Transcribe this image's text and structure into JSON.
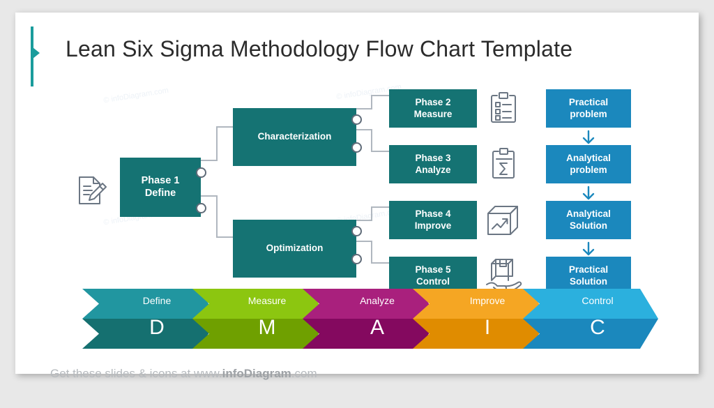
{
  "slide": {
    "title": "Lean Six Sigma Methodology Flow Chart Template",
    "watermark": "© infoDiagram.com",
    "accent_color": "#1a9c9c",
    "background": "#ffffff"
  },
  "diagram": {
    "colors": {
      "teal": "#157373",
      "blue": "#1b88bd",
      "connector": "#b0b7bf",
      "icon": "#6b7683"
    },
    "root": {
      "label_line1": "Phase 1",
      "label_line2": "Define",
      "icon": "document-pencil-icon"
    },
    "branches": [
      {
        "label": "Characterization"
      },
      {
        "label": "Optimization"
      }
    ],
    "phases": [
      {
        "label_line1": "Phase 2",
        "label_line2": "Measure",
        "icon": "clipboard-checklist-icon"
      },
      {
        "label_line1": "Phase 3",
        "label_line2": "Analyze",
        "icon": "clipboard-sigma-icon"
      },
      {
        "label_line1": "Phase 4",
        "label_line2": "Improve",
        "icon": "box-growth-arrow-icon"
      },
      {
        "label_line1": "Phase 5",
        "label_line2": "Control",
        "icon": "box-on-hand-icon"
      }
    ],
    "outcomes": [
      {
        "line1": "Practical",
        "line2": "problem"
      },
      {
        "line1": "Analytical",
        "line2": "problem"
      },
      {
        "line1": "Analytical",
        "line2": "Solution"
      },
      {
        "line1": "Practical",
        "line2": "Solution"
      }
    ]
  },
  "dmaic": {
    "steps": [
      {
        "label": "Define",
        "letter": "D",
        "top_color": "#2196a0",
        "bottom_color": "#157070"
      },
      {
        "label": "Measure",
        "letter": "M",
        "top_color": "#8cc610",
        "bottom_color": "#6fa000"
      },
      {
        "label": "Analyze",
        "letter": "A",
        "top_color": "#a9207d",
        "bottom_color": "#84095f"
      },
      {
        "label": "Improve",
        "letter": "I",
        "top_color": "#f5a623",
        "bottom_color": "#e08c00"
      },
      {
        "label": "Control",
        "letter": "C",
        "top_color": "#2bб0de",
        "bottom_color": "#1b88bd"
      }
    ]
  },
  "footer": {
    "prefix": "Get these slides & icons at www.",
    "brand": "infoDiagram",
    "suffix": ".com"
  }
}
